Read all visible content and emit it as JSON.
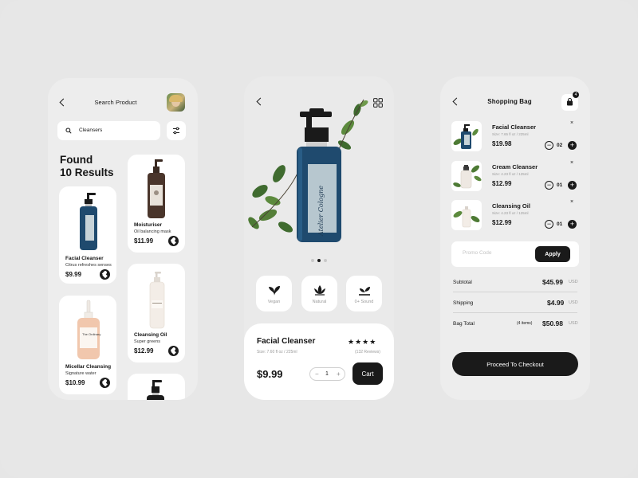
{
  "search_screen": {
    "title": "Search Product",
    "search_value": "Cleansers",
    "found_line1": "Found",
    "found_line2": "10 Results",
    "products": [
      {
        "name": "Facial Cleanser",
        "desc": "Citrus refreshes senses",
        "price": "$9.99"
      },
      {
        "name": "Moisturiser",
        "desc": "Oil balancing mask",
        "price": "$11.99"
      },
      {
        "name": "Micellar Cleansing",
        "desc": "Signature water",
        "price": "$10.99"
      },
      {
        "name": "Cleansing Oil",
        "desc": "Super greens",
        "price": "$12.99"
      }
    ],
    "bottle_label": "The Ordinary"
  },
  "detail_screen": {
    "bottle_brand": "Atelier Cologne",
    "features": [
      {
        "label": "Vegan",
        "icon": "leaf-icon"
      },
      {
        "label": "Natural",
        "icon": "lotus-icon"
      },
      {
        "label": "0+ Sound",
        "icon": "sprout-icon"
      }
    ],
    "product_name": "Facial Cleanser",
    "stars": "★★★★",
    "size": "Size: 7.60 fl oz / 225ml",
    "reviews": "(132 Reviews)",
    "price": "$9.99",
    "qty_minus": "−",
    "qty": "1",
    "qty_plus": "+",
    "cart_label": "Cart"
  },
  "bag_screen": {
    "title": "Shopping Bag",
    "bag_count": "4",
    "items": [
      {
        "name": "Facial Cleanser",
        "size": "Size: 7.65 fl oz / 225ml",
        "price": "$19.98",
        "qty": "02"
      },
      {
        "name": "Cream Cleanser",
        "size": "Size: 4.23 fl oz / 125ml",
        "price": "$12.99",
        "qty": "01"
      },
      {
        "name": "Cleansing Oil",
        "size": "Size: 4.23 fl oz / 125ml",
        "price": "$12.99",
        "qty": "01"
      }
    ],
    "remove_symbol": "×",
    "minus_symbol": "−",
    "plus_symbol": "+",
    "promo_placeholder": "Promo Code",
    "apply_label": "Apply",
    "subtotal_label": "Subtotal",
    "subtotal_value": "$45.99",
    "shipping_label": "Shipping",
    "shipping_value": "$4.99",
    "total_label": "Bag Total",
    "total_items": "(4 items)",
    "total_value": "$50.98",
    "currency": "USD",
    "checkout_label": "Proceed To Checkout"
  },
  "colors": {
    "accent": "#1a1a1a",
    "card": "#ffffff",
    "background": "#e7e7e7",
    "bottle": "#1f4a6e"
  }
}
